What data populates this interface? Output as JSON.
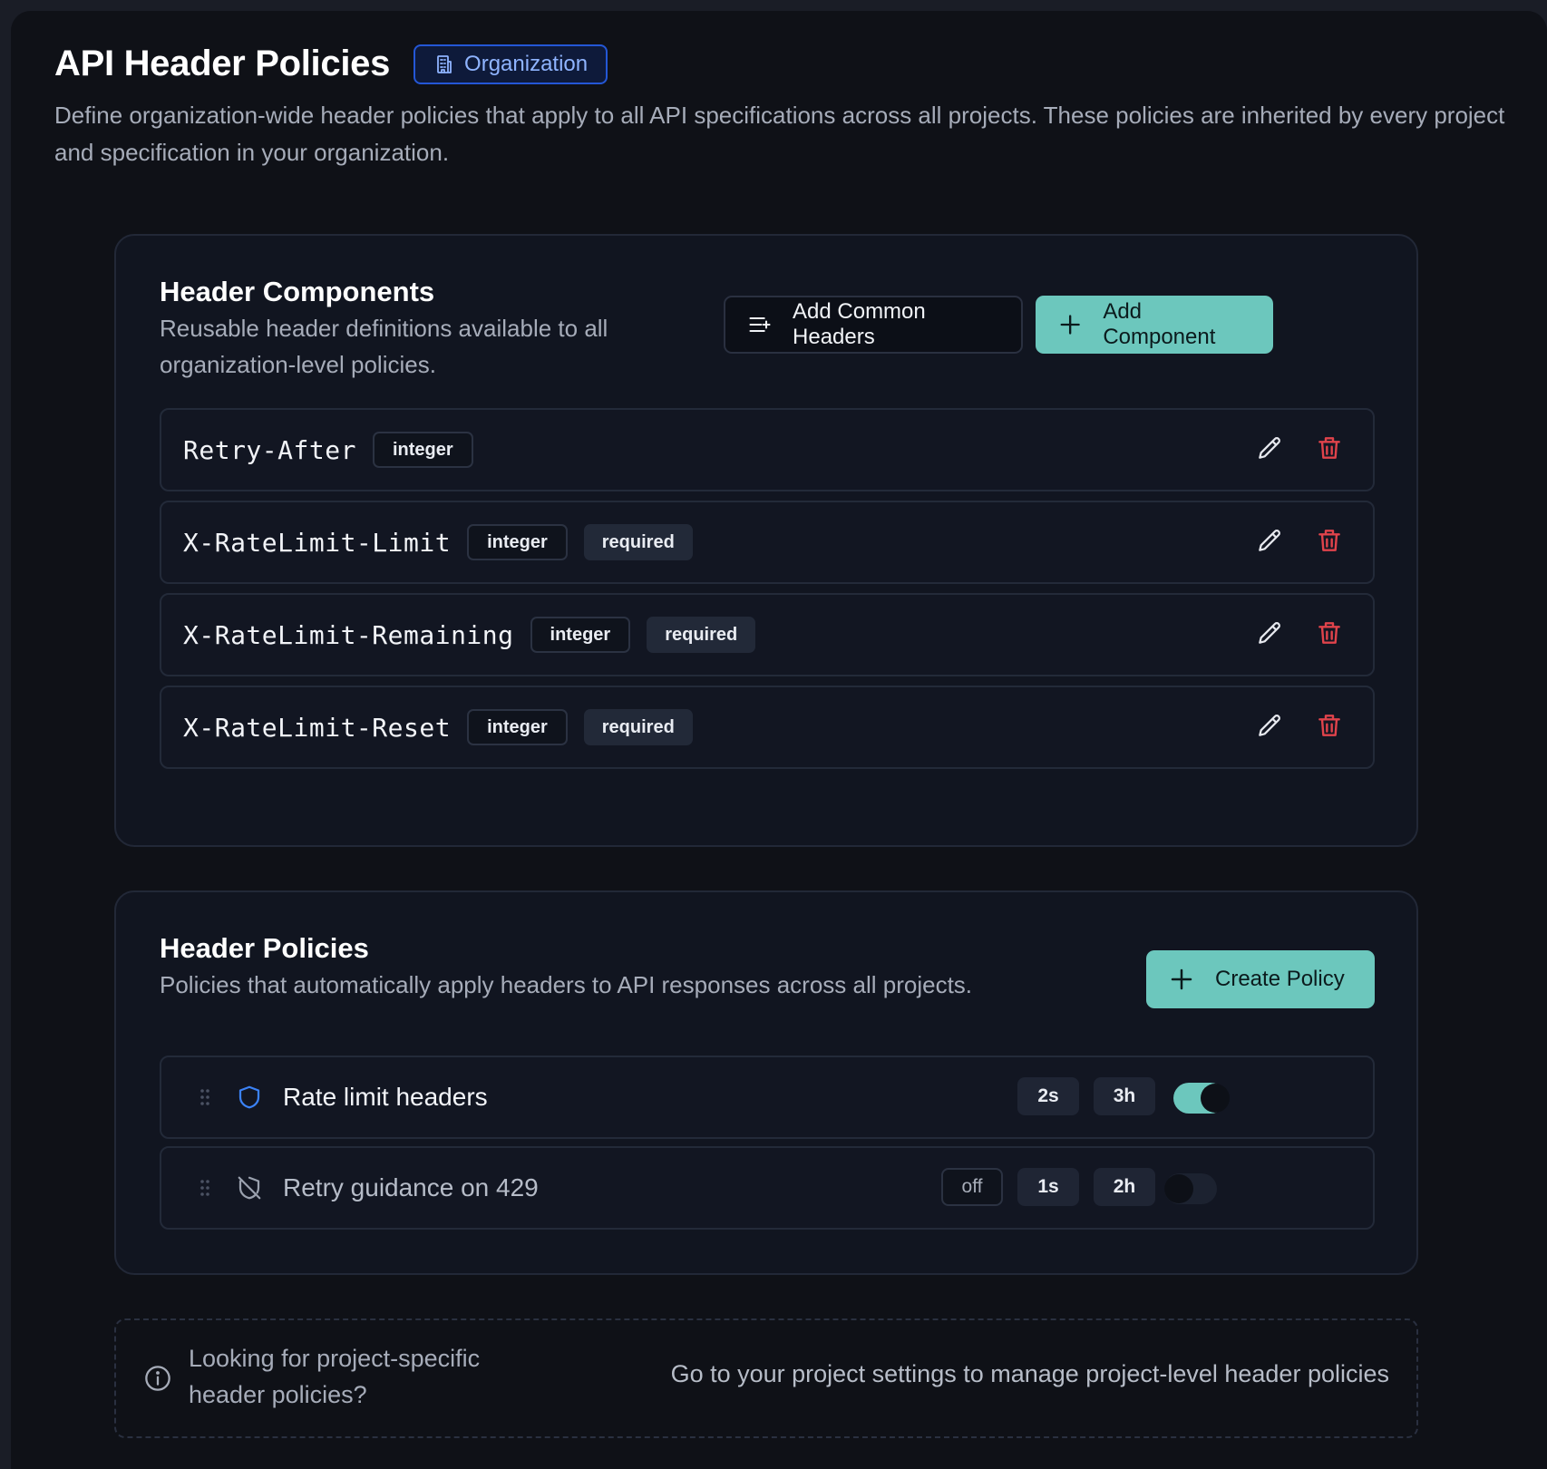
{
  "page": {
    "title": "API Header Policies",
    "scope_badge": "Organization",
    "description": "Define organization-wide header policies that apply to all API specifications across all projects. These policies are inherited by every project and specification in your organization."
  },
  "components": {
    "title": "Header Components",
    "subtitle": "Reusable header definitions available to all organization-level policies.",
    "add_common_label": "Add Common Headers",
    "add_component_label": "Add Component",
    "items": [
      {
        "name": "Retry-After",
        "type": "integer",
        "required": ""
      },
      {
        "name": "X-RateLimit-Limit",
        "type": "integer",
        "required": "required"
      },
      {
        "name": "X-RateLimit-Remaining",
        "type": "integer",
        "required": "required"
      },
      {
        "name": "X-RateLimit-Reset",
        "type": "integer",
        "required": "required"
      }
    ]
  },
  "policies": {
    "title": "Header Policies",
    "subtitle": "Policies that automatically apply headers to API responses across all projects.",
    "create_label": "Create Policy",
    "items": [
      {
        "name": "Rate limit headers",
        "icon": "shield-icon",
        "pills": [
          "2s",
          "3h"
        ],
        "enabled": true
      },
      {
        "name": "Retry guidance on 429",
        "icon": "shield-off-icon",
        "status": "off",
        "pills": [
          "1s",
          "2h"
        ],
        "enabled": false
      }
    ]
  },
  "info": {
    "question": "Looking for project-specific header policies?",
    "link": "Go to your project settings to manage project-level header policies"
  },
  "colors": {
    "accent": "#6cc7bd",
    "badge_border": "#2457d6",
    "danger": "#e0434b",
    "background": "#0f1117"
  }
}
